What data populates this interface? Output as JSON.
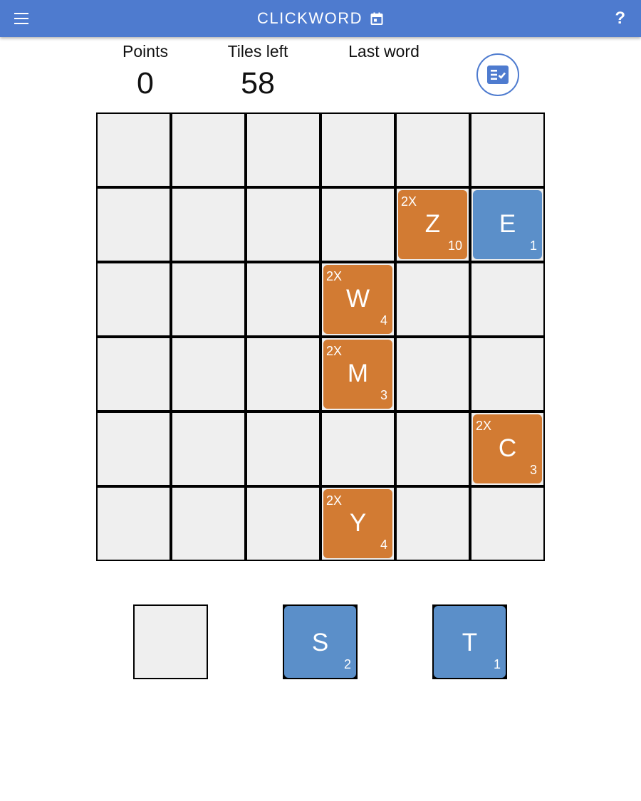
{
  "app": {
    "title": "CLICKWORD",
    "accent_color": "#4e7bcf",
    "menu_icon": "menu-icon",
    "title_icon": "calendar-icon",
    "help_label": "?"
  },
  "stats": {
    "points_label": "Points",
    "points_value": "0",
    "tiles_left_label": "Tiles left",
    "tiles_left_value": "58",
    "last_word_label": "Last word",
    "last_word_value": ""
  },
  "submit_icon": "checklist-icon",
  "colors": {
    "multiplier_tile": "#d27b33",
    "letter_tile": "#5b8fc9",
    "empty_cell": "#efefef"
  },
  "board": {
    "size": 6,
    "tiles": [
      {
        "row": 1,
        "col": 4,
        "letter": "Z",
        "score": "10",
        "multiplier": "2X",
        "kind": "orange"
      },
      {
        "row": 1,
        "col": 5,
        "letter": "E",
        "score": "1",
        "multiplier": "",
        "kind": "blue"
      },
      {
        "row": 2,
        "col": 3,
        "letter": "W",
        "score": "4",
        "multiplier": "2X",
        "kind": "orange"
      },
      {
        "row": 3,
        "col": 3,
        "letter": "M",
        "score": "3",
        "multiplier": "2X",
        "kind": "orange"
      },
      {
        "row": 4,
        "col": 5,
        "letter": "C",
        "score": "3",
        "multiplier": "2X",
        "kind": "orange"
      },
      {
        "row": 5,
        "col": 3,
        "letter": "Y",
        "score": "4",
        "multiplier": "2X",
        "kind": "orange"
      }
    ]
  },
  "rack": [
    {
      "letter": "",
      "score": "",
      "empty": true
    },
    {
      "letter": "S",
      "score": "2",
      "empty": false
    },
    {
      "letter": "T",
      "score": "1",
      "empty": false
    }
  ]
}
